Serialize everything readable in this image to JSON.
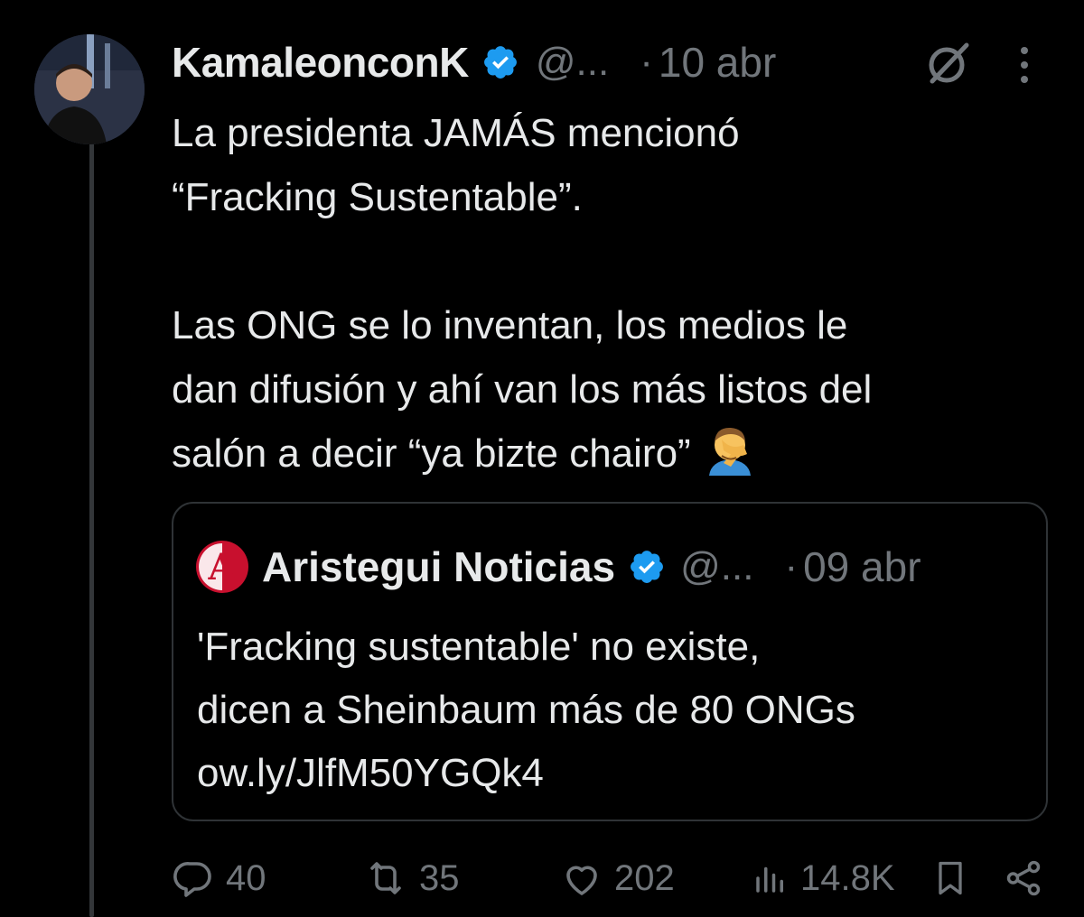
{
  "colors": {
    "background": "#000000",
    "text": "#e7e9ea",
    "muted": "#71767b",
    "verified": "#1d9bf0",
    "border": "#2f3336",
    "aristegui_red": "#c8102e"
  },
  "tweet": {
    "author": {
      "name": "KamaleonconK",
      "handle": "@...",
      "verified_icon": "verified-badge-icon",
      "avatar_icon": "avatar-photo"
    },
    "separator": "·",
    "date": "10 abr",
    "text_lines": [
      "La presidenta JAMÁS mencionó",
      "“Fracking Sustentable”.",
      "Las ONG se lo inventan, los medios le",
      "dan difusión y ahí van los más listos del",
      "salón a decir “ya bizte chairo”"
    ],
    "emoji": "face-palm-emoji",
    "quoted": {
      "name": "Aristegui Noticias",
      "handle": "@...",
      "separator": "·",
      "date": "09 abr",
      "logo_icon": "aristegui-logo",
      "logo_letter": "A",
      "text_lines": [
        "'Fracking sustentable' no existe,",
        "dicen a Sheinbaum más de 80 ONGs",
        "ow.ly/JlfM50YGQk4"
      ]
    },
    "metrics": {
      "replies": "40",
      "reposts": "35",
      "likes": "202",
      "views": "14.8K"
    }
  }
}
